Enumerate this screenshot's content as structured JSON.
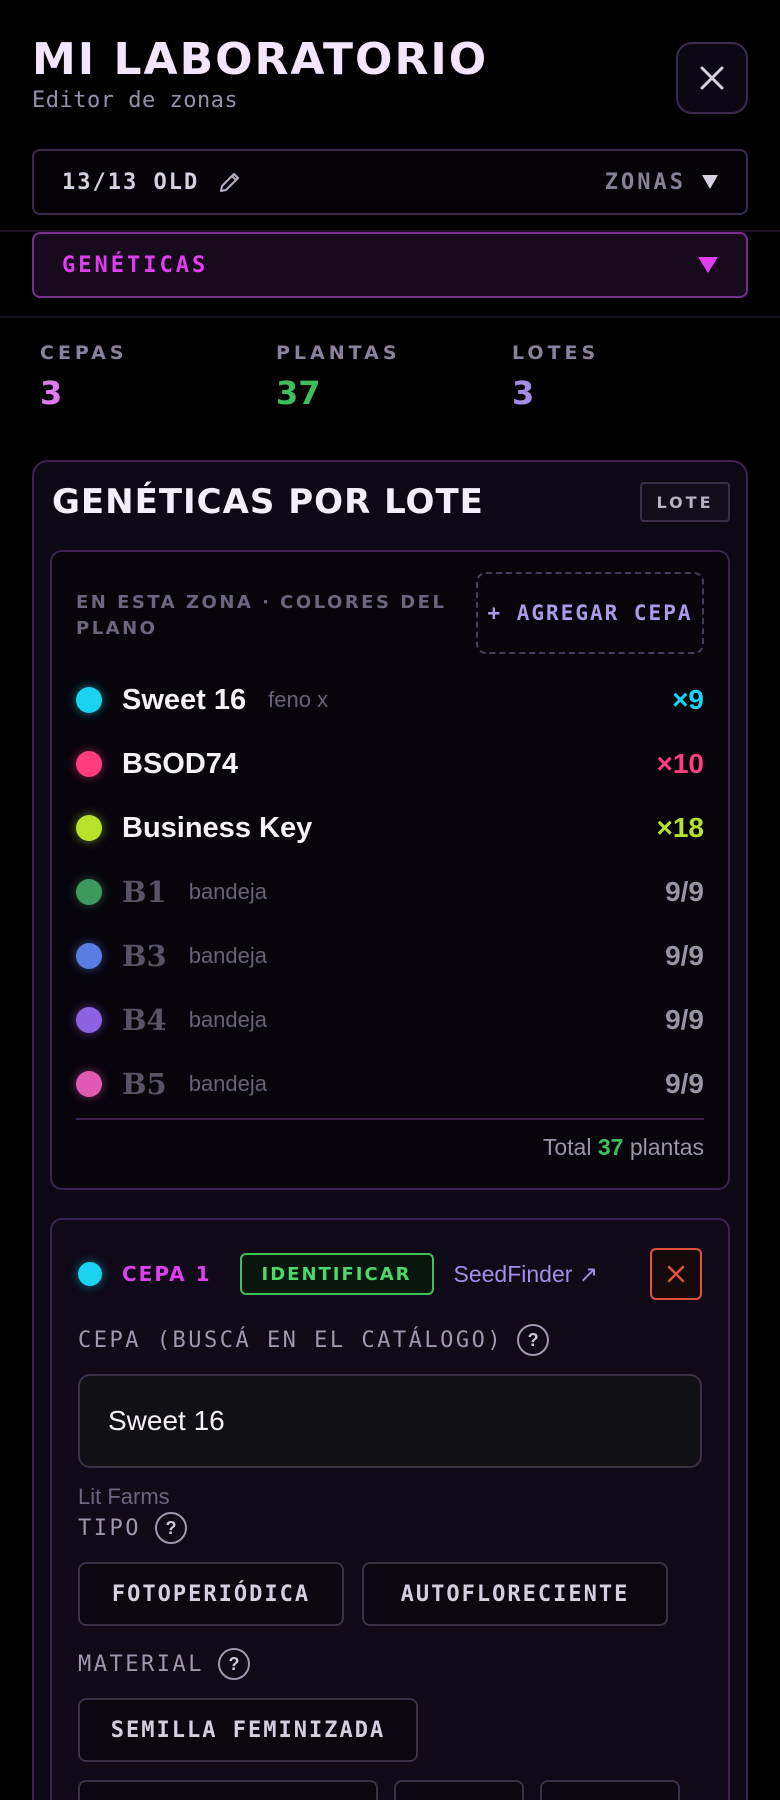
{
  "header": {
    "title": "MI LABORATORIO",
    "subtitle": "Editor de zonas"
  },
  "room_selector": {
    "label": "13/13 OLD",
    "zones_label": "ZONAS"
  },
  "genetics_selector": {
    "label": "GENÉTICAS"
  },
  "stats": [
    {
      "label": "CEPAS",
      "value": "3",
      "color": "#e07af0"
    },
    {
      "label": "PLANTAS",
      "value": "37",
      "color": "#3fbf5a"
    },
    {
      "label": "LOTES",
      "value": "3",
      "color": "#a48de6"
    }
  ],
  "card": {
    "title": "GENÉTICAS POR LOTE",
    "badge": "LOTE",
    "caption": "EN ESTA ZONA · COLORES DEL PLANO",
    "add_button": "+ AGREGAR CEPA",
    "strains": [
      {
        "name": "Sweet 16",
        "note": "feno x",
        "count": "×9",
        "color": "#1ad3f0",
        "dim": false
      },
      {
        "name": "BSOD74",
        "note": "",
        "count": "×10",
        "color": "#ff3d7f",
        "dim": false
      },
      {
        "name": "Business Key",
        "note": "",
        "count": "×18",
        "color": "#b6e22a",
        "dim": false
      },
      {
        "name": "B1",
        "note": "bandeja",
        "count": "9/9",
        "color": "#3d9a5c",
        "dim": true
      },
      {
        "name": "B3",
        "note": "bandeja",
        "count": "9/9",
        "color": "#5a7ee0",
        "dim": true
      },
      {
        "name": "B4",
        "note": "bandeja",
        "count": "9/9",
        "color": "#8c62e0",
        "dim": true
      },
      {
        "name": "B5",
        "note": "bandeja",
        "count": "9/9",
        "color": "#e05ab4",
        "dim": true
      }
    ],
    "total": {
      "prefix": "Total",
      "value": "37",
      "suffix": "plantas"
    }
  },
  "cepa": {
    "label": "CEPA 1",
    "identify": "IDENTIFICAR",
    "seedfinder": "SeedFinder ↗",
    "search_label": "CEPA (BUSCÁ EN EL CATÁLOGO)",
    "search_value": "Sweet 16",
    "breeder": "Lit Farms",
    "tipo_label": "TIPO",
    "tipo_options": [
      "FOTOPERIÓDICA",
      "AUTOFLORECIENTE"
    ],
    "material_label": "MATERIAL",
    "material_options": [
      "SEMILLA FEMINIZADA"
    ]
  }
}
